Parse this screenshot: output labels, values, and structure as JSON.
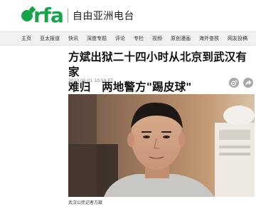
{
  "site": {
    "logo_text": "rfa",
    "name": "自由亚洲电台",
    "brand_color": "#17a34a"
  },
  "nav": {
    "items": [
      "主页",
      "亚太报道",
      "快讯",
      "深度专题",
      "评论",
      "专栏",
      "视频",
      "原创漫画",
      "海外查核",
      "网友投稿"
    ]
  },
  "article": {
    "headline_line1": "方斌出狱二十四小时从北京到武汉有家",
    "headline_line2": "难归　两地警方\"踢皮球\"",
    "date": "2023.05.01  10:59 ET",
    "photo_caption": "武汉公民记者方斌",
    "share_icons": [
      "weibo-icon",
      "share-icon"
    ]
  }
}
